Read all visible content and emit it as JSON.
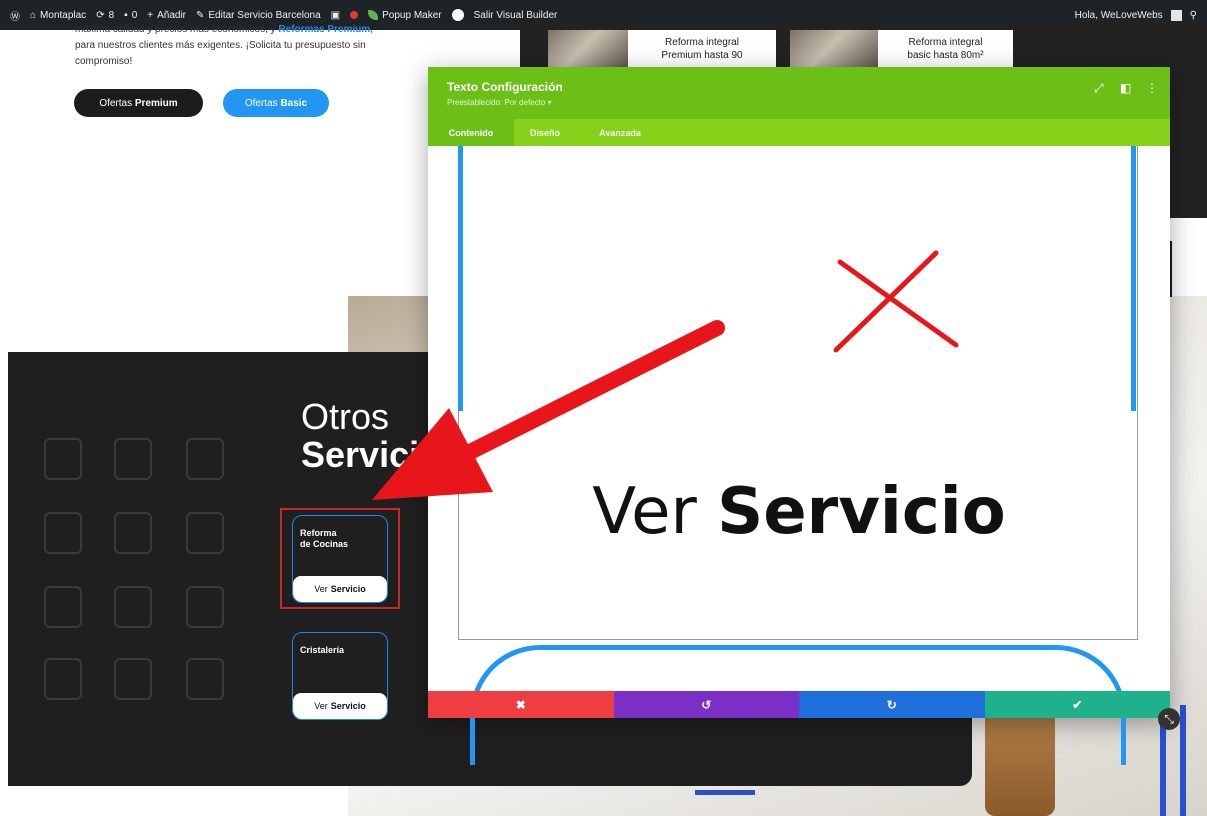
{
  "admin_bar": {
    "site_name": "Montaplac",
    "updates": "8",
    "comments": "0",
    "add_new": "Añadir",
    "edit_page": "Editar Servicio Barcelona",
    "popup_maker": "Popup Maker",
    "exit_builder": "Salir Visual Builder",
    "greeting": "Hola, WeLoveWebs"
  },
  "intro": {
    "line1": "máxima calidad y precios más económicos, y",
    "line1_link": "Reformas Premium,",
    "line2": "para nuestros clientes más exigentes. ¡Solicita tu presupuesto sin",
    "line3": "compromiso!"
  },
  "buttons": {
    "premium_prefix": "Ofertas",
    "premium_strong": "Premium",
    "basic_prefix": "Ofertas",
    "basic_strong": "Basic"
  },
  "photo_cards": [
    {
      "line1": "Reforma integral",
      "line2": "Premium hasta 90"
    },
    {
      "line1": "Reforma integral",
      "line2": "basic hasta 80m²"
    }
  ],
  "section": {
    "title_light": "Otros",
    "title_bold": "Servicios"
  },
  "service_cards": [
    {
      "title_line1": "Reforma",
      "title_line2": "de Cocinas",
      "btn_prefix": "Ver",
      "btn_strong": "Servicio"
    },
    {
      "title_line1": "Cristalería",
      "title_line2": "",
      "btn_prefix": "Ver",
      "btn_strong": "Servicio"
    }
  ],
  "modal": {
    "title": "Texto Configuración",
    "subtitle": "Preestablecido: Por defecto ▾",
    "tabs": [
      "Contenido",
      "Diseño",
      "Avanzada"
    ],
    "content_prefix": "Ver",
    "content_strong": "Servicio",
    "footer": {
      "cancel": "✖",
      "undo": "↺",
      "redo": "↻",
      "save": "✔"
    }
  },
  "colors": {
    "modal_header": "#6bbf17",
    "modal_tabs": "#86d11a",
    "accent_blue": "#2196f3",
    "annotation_red": "#e8161b",
    "dark_section": "#1f1f20"
  }
}
